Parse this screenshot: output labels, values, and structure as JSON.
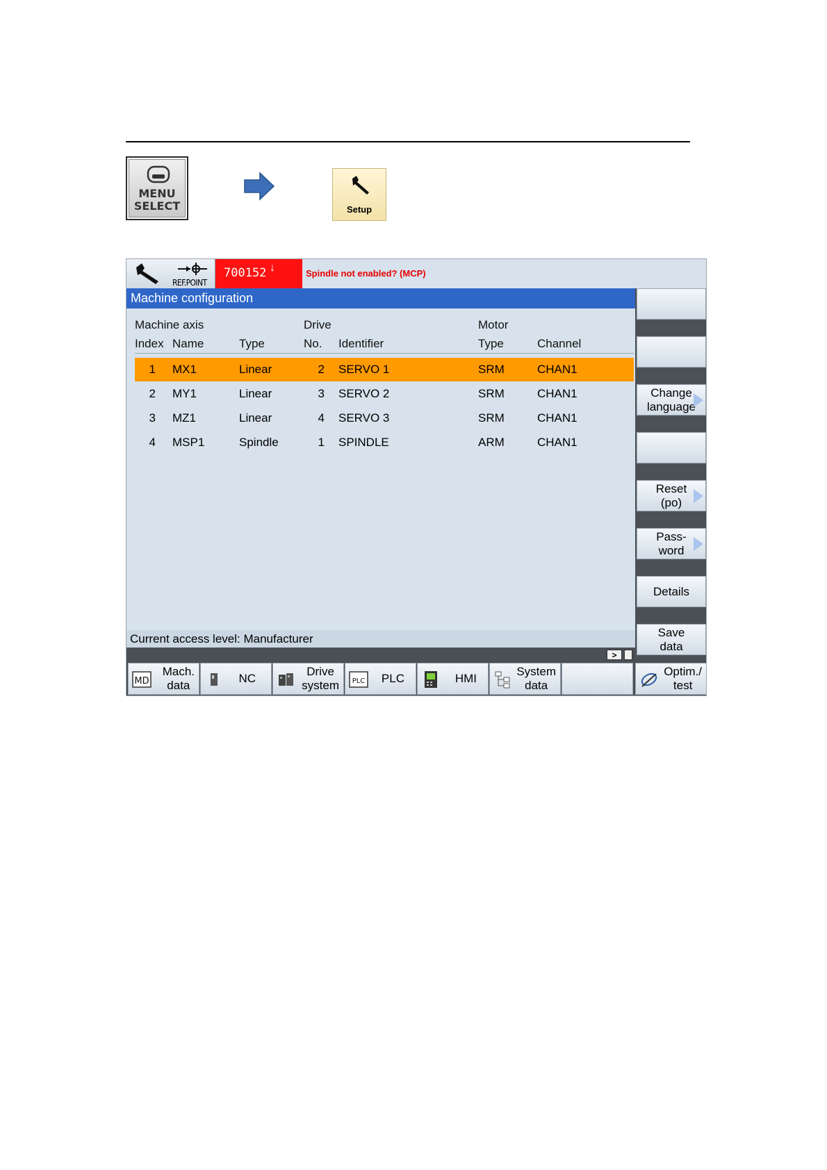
{
  "instruction": {
    "menu_key": {
      "label": "MENU\nSELECT",
      "icon": "menu-select-icon"
    },
    "arrow_icon": "right-arrow-icon",
    "setup_key": {
      "label": "Setup",
      "icon": "wrench-icon"
    }
  },
  "hmi": {
    "header": {
      "mode_icon": "wrench-icon",
      "refpoint_label": "REF.POINT",
      "alarm_number": "700152",
      "alarm_arrow": "↓",
      "alarm_text": "Spindle not enabled? (MCP)"
    },
    "title": "Machine configuration",
    "table": {
      "group_headers": {
        "machine_axis": "Machine axis",
        "drive": "Drive",
        "motor": "Motor"
      },
      "columns": {
        "index": "Index",
        "name": "Name",
        "type": "Type",
        "no": "No.",
        "identifier": "Identifier",
        "motor_type": "Type",
        "channel": "Channel"
      },
      "rows": [
        {
          "index": "1",
          "name": "MX1",
          "type": "Linear",
          "no": "2",
          "identifier": "SERVO 1",
          "motor_type": "SRM",
          "channel": "CHAN1",
          "selected": true
        },
        {
          "index": "2",
          "name": "MY1",
          "type": "Linear",
          "no": "3",
          "identifier": "SERVO 2",
          "motor_type": "SRM",
          "channel": "CHAN1",
          "selected": false
        },
        {
          "index": "3",
          "name": "MZ1",
          "type": "Linear",
          "no": "4",
          "identifier": "SERVO 3",
          "motor_type": "SRM",
          "channel": "CHAN1",
          "selected": false
        },
        {
          "index": "4",
          "name": "MSP1",
          "type": "Spindle",
          "no": "1",
          "identifier": "SPINDLE",
          "motor_type": "ARM",
          "channel": "CHAN1",
          "selected": false
        }
      ]
    },
    "status": "Current access level: Manufacturer",
    "more_label": ">",
    "vertical_softkeys": [
      "",
      "",
      "Change\nlanguage",
      "",
      "Reset\n(po)",
      "Pass-\nword",
      "Details",
      "Save\ndata"
    ],
    "horizontal_softkeys": [
      "Mach.\ndata",
      "NC",
      "Drive\nsystem",
      "PLC",
      "HMI",
      "System\ndata",
      "",
      "Optim./\ntest"
    ],
    "colors": {
      "title_bar": "#2f67c9",
      "selected_row": "#ff9a00",
      "alarm": "#ff1111",
      "background": "#d7e2ec"
    }
  }
}
